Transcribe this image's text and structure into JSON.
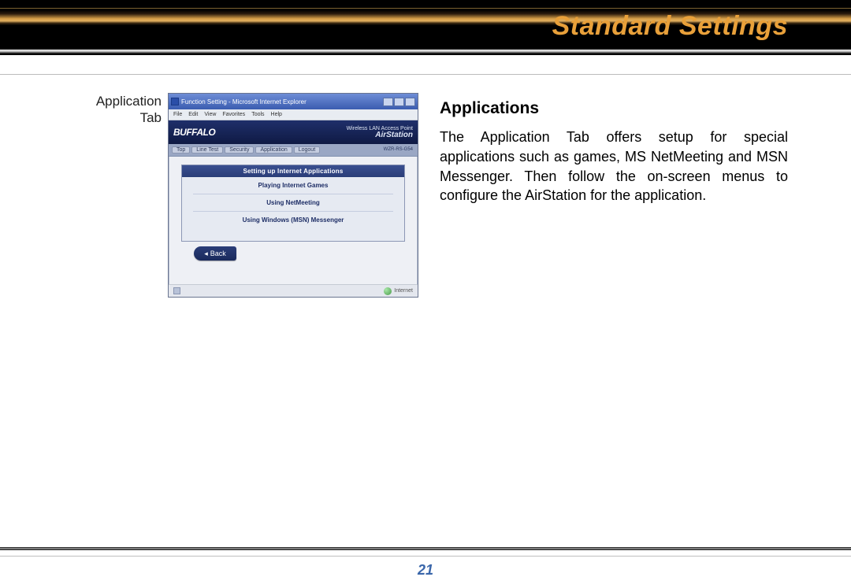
{
  "header": {
    "title": "Standard Settings"
  },
  "caption": {
    "label": "Application Tab"
  },
  "section": {
    "heading": "Applications",
    "body": "The Application Tab offers setup for special applications such as games, MS NetMeeting and MSN Messenger.  Then follow the on-screen menus to configure the AirStation for the application."
  },
  "screenshot": {
    "window_title": "Function Setting - Microsoft Internet Explorer",
    "menubar": [
      "File",
      "Edit",
      "View",
      "Favorites",
      "Tools",
      "Help"
    ],
    "logo": "BUFFALO",
    "brand_small": "Wireless LAN Access Point",
    "brand_big": "AirStation",
    "tabs": [
      "Top",
      "Line Test",
      "Security",
      "Application",
      "Logout"
    ],
    "ip": "WZR-RS-G54",
    "panel_title": "Setting up Internet Applications",
    "links": [
      "Playing Internet Games",
      "Using NetMeeting",
      "Using Windows (MSN) Messenger"
    ],
    "back_label": "Back",
    "status_right": "Internet"
  },
  "page_number": "21"
}
